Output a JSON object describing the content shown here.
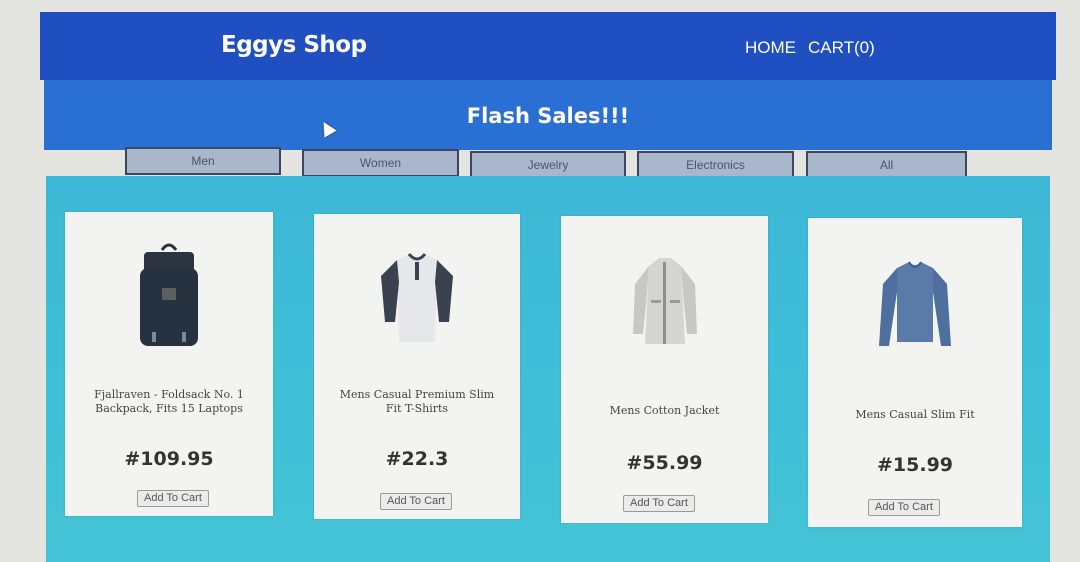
{
  "header": {
    "brand": "Eggys Shop",
    "nav": {
      "home": "HOME",
      "cart": "CART(0)"
    }
  },
  "banner": {
    "title": "Flash Sales!!!"
  },
  "categories": [
    "Men",
    "Women",
    "Jewelry",
    "Electronics",
    "All"
  ],
  "products": [
    {
      "name": "Fjallraven - Foldsack No. 1 Backpack, Fits 15 Laptops",
      "price": "#109.95",
      "button": "Add To Cart",
      "icon": "backpack-icon"
    },
    {
      "name": "Mens Casual Premium Slim Fit T-Shirts",
      "price": "#22.3",
      "button": "Add To Cart",
      "icon": "tshirt-icon"
    },
    {
      "name": "Mens Cotton Jacket",
      "price": "#55.99",
      "button": "Add To Cart",
      "icon": "jacket-icon"
    },
    {
      "name": "Mens Casual Slim Fit",
      "price": "#15.99",
      "button": "Add To Cart",
      "icon": "longsleeve-icon"
    }
  ],
  "colors": {
    "header": "#1f4fc0",
    "banner": "#2a6fd4",
    "content": "#3db8d6",
    "tab": "#a9b6cc"
  }
}
